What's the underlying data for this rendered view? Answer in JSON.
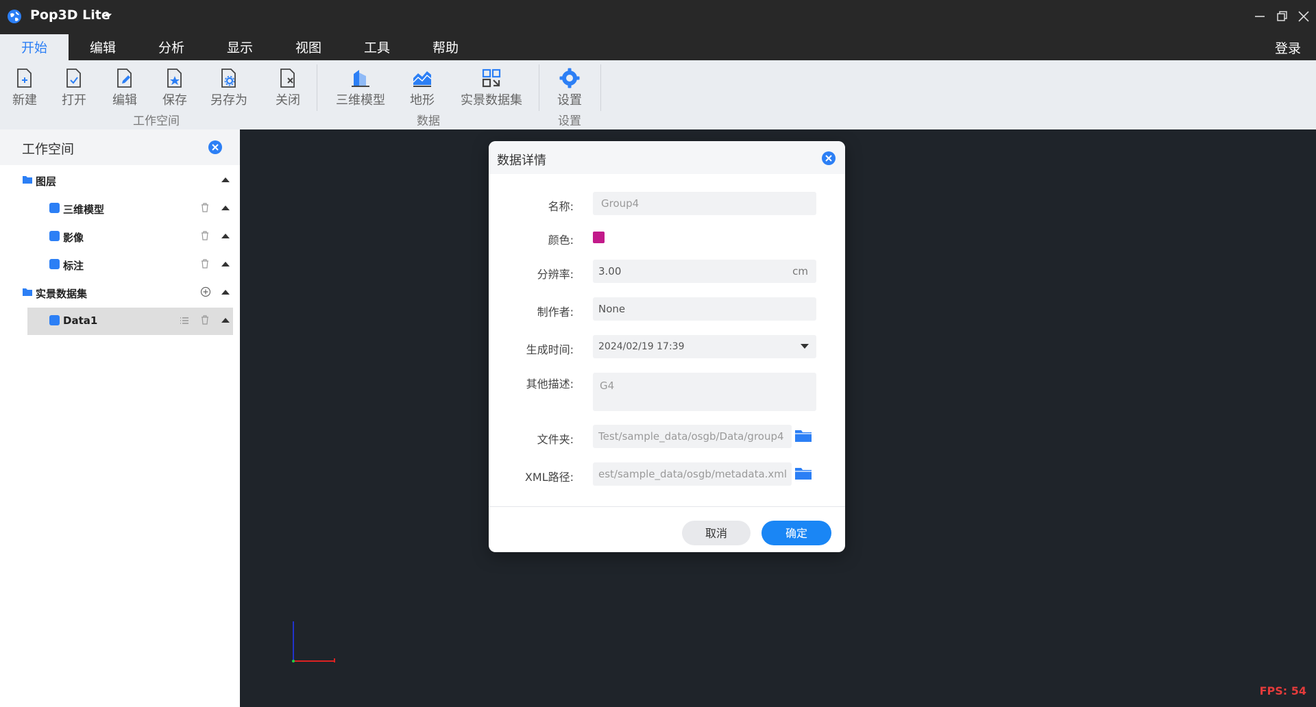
{
  "app": {
    "title": "Pop3D Lite",
    "login": "登录"
  },
  "menu": [
    "开始",
    "编辑",
    "分析",
    "显示",
    "视图",
    "工具",
    "帮助"
  ],
  "ribbon": {
    "workspace_tools": [
      "新建",
      "打开",
      "编辑",
      "保存",
      "另存为",
      "关闭"
    ],
    "data_tools": [
      "三维模型",
      "地形",
      "实景数据集"
    ],
    "settings_tools": [
      "设置"
    ],
    "group_labels": {
      "workspace": "工作空间",
      "data": "数据",
      "settings": "设置"
    }
  },
  "panel": {
    "title": "工作空间",
    "layers_group": "图层",
    "layers": [
      "三维模型",
      "影像",
      "标注"
    ],
    "dataset_group": "实景数据集",
    "datasets": [
      "Data1"
    ]
  },
  "dialog": {
    "title": "数据详情",
    "labels": {
      "name": "名称:",
      "color": "颜色:",
      "resolution": "分辨率:",
      "author": "制作者:",
      "created": "生成时间:",
      "description": "其他描述:",
      "folder": "文件夹:",
      "xml": "XML路径:"
    },
    "values": {
      "name": "Group4",
      "color": "#c21a8a",
      "resolution": "3.00",
      "resolution_unit": "cm",
      "author": "None",
      "created": "2024/02/19 17:39",
      "description": "G4",
      "folder": "Test/sample_data/osgb/Data/group4",
      "xml": "est/sample_data/osgb/metadata.xml"
    },
    "cancel": "取消",
    "ok": "确定"
  },
  "viewport": {
    "fps": "FPS: 54"
  },
  "colors": {
    "accent": "#2c7ff5",
    "titlebar": "#282828",
    "ribbon": "#eaedf1",
    "viewport": "#1f242a"
  }
}
